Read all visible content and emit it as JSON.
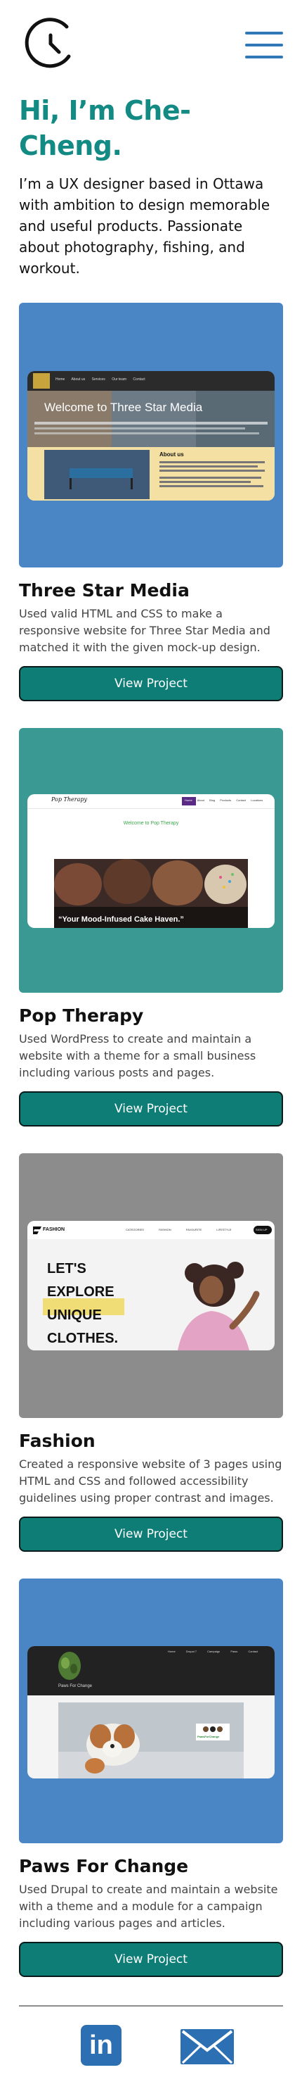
{
  "header": {
    "logo_icon": "clock-logo-icon",
    "menu_icon": "hamburger-menu-icon",
    "accent": "#2f77b6"
  },
  "hero": {
    "title": "Hi, I’m Che-Cheng.",
    "intro": "I’m a UX designer based in Ottawa with ambition to design memorable and useful products. Passionate about photography, fishing, and workout.",
    "title_color": "#138a83"
  },
  "projects": [
    {
      "title": "Three Star Media",
      "description": "Used valid HTML and CSS to make a responsive website for Three Star Media and matched it with the given mock-up design.",
      "button": "View Project",
      "bg": "#4a85c6",
      "preview": {
        "heading": "Welcome to Three Star Media",
        "nav": [
          "Home",
          "About us",
          "Services",
          "Our team",
          "Contact"
        ],
        "about_title": "About us"
      }
    },
    {
      "title": "Pop Therapy",
      "description": "Used WordPress to create and maintain a website with a theme for a small business including various posts and pages.",
      "button": "View Project",
      "bg": "#3a9a93",
      "preview": {
        "brand": "Pop Therapy",
        "nav": [
          "Home",
          "About",
          "Blog",
          "Products",
          "Contact",
          "Locations"
        ],
        "welcome": "Welcome to Pop Therapy",
        "tagline": "“Your Mood-Infused Cake Haven.”"
      }
    },
    {
      "title": "Fashion",
      "description": "Created a responsive website of 3 pages using HTML and CSS and followed accessibility guidelines using proper contrast and images.",
      "button": "View Project",
      "bg": "#8c8c8c",
      "preview": {
        "brand": "FASHION",
        "nav": [
          "CATEGORIES",
          "FASHION",
          "FAVOURITE",
          "LIFESTYLE"
        ],
        "signup": "SIGN UP",
        "lines": [
          "LET'S",
          "EXPLORE",
          "UNIQUE",
          "CLOTHES."
        ]
      }
    },
    {
      "title": "Paws For Change",
      "description": "Used Drupal to create and maintain a website with a theme and a module for a campaign including various pages and articles.",
      "button": "View Project",
      "bg": "#4a85c6",
      "preview": {
        "brand": "Paws For Change",
        "nav": [
          "Home",
          "Drupal 7",
          "Campaign",
          "Paws",
          "Contact"
        ],
        "badge": "PawsForChange"
      }
    }
  ],
  "footer": {
    "linkedin_icon": "linkedin-icon",
    "linkedin_text": "in",
    "mail_icon": "mail-icon"
  }
}
